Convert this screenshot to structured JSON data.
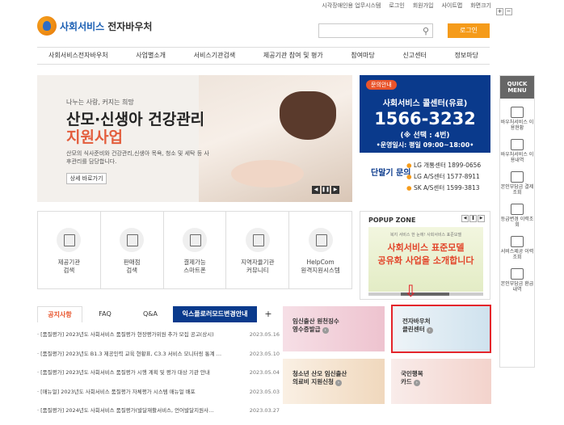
{
  "util": {
    "links": [
      "시각장애인용 업무시스템",
      "로그인",
      "회원가입",
      "사이트맵",
      "화면크기"
    ],
    "zoom_in": "+",
    "zoom_out": "−"
  },
  "header": {
    "logo_part1": "사회서비스",
    "logo_part2": "전자바우처",
    "login_label": "로그인"
  },
  "gnb": [
    "사회서비스전자바우처",
    "사업별소개",
    "서비스기관검색",
    "제공기관 참여 및 평가",
    "참여마당",
    "신고센터",
    "정보마당"
  ],
  "banner": {
    "subtitle": "나누는 사랑, 커지는 희망",
    "title1": "산모·신생아 건강관리",
    "title2": "지원사업",
    "desc": "산모의 식사준비와 건강관리,신생아 목욕, 청소 및 세탁 등 사후관리를 담당합니다.",
    "more": "상세 바로가기"
  },
  "call": {
    "tag": "문의안내",
    "title": "사회서비스 콜센터(유료)",
    "number": "1566-3232",
    "select": "(※ 선택 : 4번)",
    "hours": "•운영일시: 평일 09:00~18:00•",
    "label": "단말기 문의",
    "lines": [
      "LG 개통센터 1899-0656",
      "LG A/S센터 1577-8911",
      "SK A/S센터 1599-3813"
    ]
  },
  "quick": {
    "header": "QUICK MENU",
    "items": [
      "바우처서비스 이용현황",
      "바우처서비스 이용내역",
      "본인부담금 결제조회",
      "등급변경 이력조회",
      "서비스제공 이력조회",
      "본인부담금 환급내역"
    ]
  },
  "services": [
    {
      "label1": "제공기관",
      "label2": "검색"
    },
    {
      "label1": "판매점",
      "label2": "검색"
    },
    {
      "label1": "결제가능",
      "label2": "스마트폰"
    },
    {
      "label1": "지역자율기관",
      "label2": "커뮤니티"
    },
    {
      "label1": "HelpCom",
      "label2": "원격지원시스템"
    }
  ],
  "popup": {
    "title": "POPUP ZONE",
    "small": "복지 서비스 한 눈에! 사회서비스 표준모델",
    "line1": "사회서비스 표준모델",
    "line2": "공유화 사업을 소개합니다"
  },
  "tabs": [
    "공지사항",
    "FAQ",
    "Q&A",
    "익스플로러모드변경안내",
    "+"
  ],
  "notices": [
    {
      "title": "· [품질평가] 2023년도 사회서비스 품질평가 현장평가위원 추가 모집 공고(상시)",
      "date": "2023.05.16"
    },
    {
      "title": "· [품질평가] 2023년도 B1.3 제공인력 교육 현황표, C3.3 서비스 모니터링 통계 …",
      "date": "2023.05.10"
    },
    {
      "title": "· [품질평가] 2023년도 사회서비스 품질평가 시행 계획 및 평가 대상 기관 안내",
      "date": "2023.05.04"
    },
    {
      "title": "· [매뉴얼] 2023년도 사회서비스 품질평가 자체평가 시스템 매뉴얼 배포",
      "date": "2023.05.03"
    },
    {
      "title": "· [품질평가] 2024년도 사회서비스 품질평가(발달재활서비스, 언어발달지원사…",
      "date": "2023.03.27"
    }
  ],
  "cards": [
    {
      "line1": "임신출산 원천징수",
      "line2": "영수증발급"
    },
    {
      "line1": "전자바우처",
      "line2": "클린센터"
    },
    {
      "line1": "청소년 산모 임신출산",
      "line2": "의료비 지원신청"
    },
    {
      "line1": "국민행복",
      "line2": "카드"
    }
  ],
  "arrow": "⇩"
}
